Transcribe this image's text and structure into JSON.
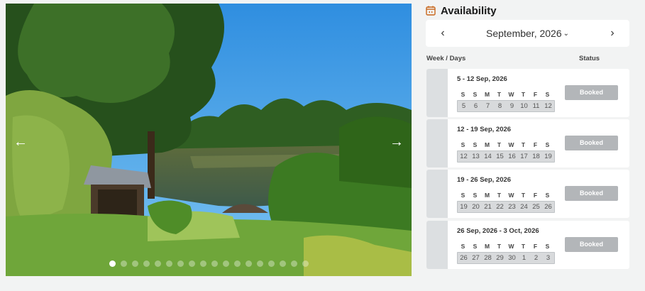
{
  "gallery": {
    "prev_icon": "arrow-left-icon",
    "next_icon": "arrow-right-icon",
    "prev_glyph": "←",
    "next_glyph": "→",
    "slide_count": 18,
    "active_slide": 1
  },
  "availability": {
    "icon": "calendar-icon",
    "title": "Availability",
    "month": "September, 2026",
    "caret": "⌄",
    "prev_glyph": "‹",
    "next_glyph": "›",
    "col_week": "Week / Days",
    "col_status": "Status",
    "weeks": [
      {
        "range": "5 - 12 Sep, 2026",
        "days": [
          "S",
          "S",
          "M",
          "T",
          "W",
          "T",
          "F",
          "S"
        ],
        "dates": [
          "5",
          "6",
          "7",
          "8",
          "9",
          "10",
          "11",
          "12"
        ],
        "status": "Booked"
      },
      {
        "range": "12 - 19 Sep, 2026",
        "days": [
          "S",
          "S",
          "M",
          "T",
          "W",
          "T",
          "F",
          "S"
        ],
        "dates": [
          "12",
          "13",
          "14",
          "15",
          "16",
          "17",
          "18",
          "19"
        ],
        "status": "Booked"
      },
      {
        "range": "19 - 26 Sep, 2026",
        "days": [
          "S",
          "S",
          "M",
          "T",
          "W",
          "T",
          "F",
          "S"
        ],
        "dates": [
          "19",
          "20",
          "21",
          "22",
          "23",
          "24",
          "25",
          "26"
        ],
        "status": "Booked"
      },
      {
        "range": "26 Sep, 2026 - 3 Oct, 2026",
        "days": [
          "S",
          "S",
          "M",
          "T",
          "W",
          "T",
          "F",
          "S"
        ],
        "dates": [
          "26",
          "27",
          "28",
          "29",
          "30",
          "1",
          "2",
          "3"
        ],
        "status": "Booked"
      }
    ]
  },
  "colors": {
    "page_bg": "#f2f3f3",
    "booked": "#b3b6b9",
    "icon_accent": "#c8651b"
  }
}
